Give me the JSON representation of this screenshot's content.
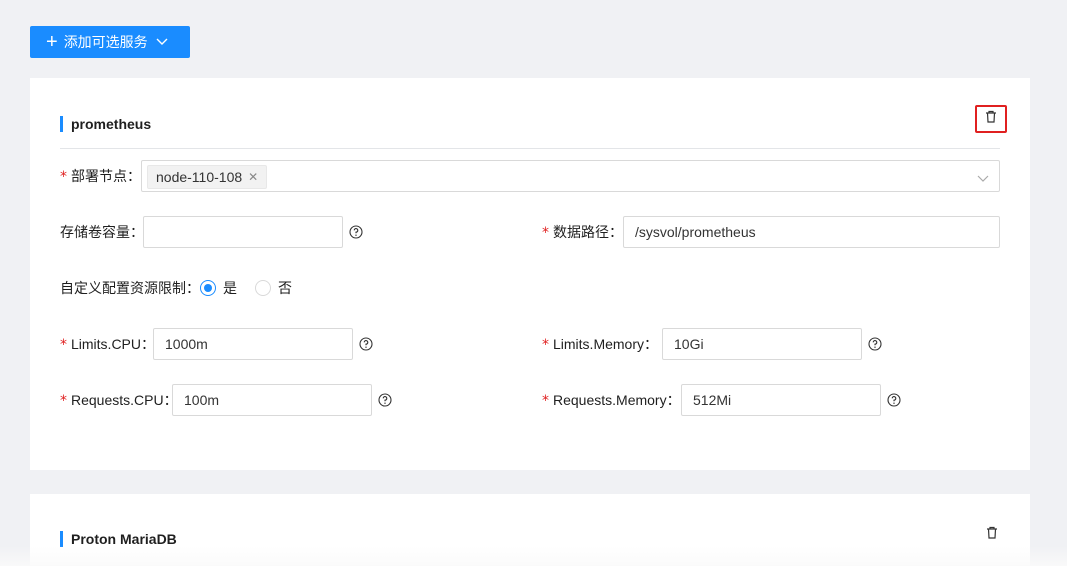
{
  "toolbar": {
    "add_label": "添加可选服务"
  },
  "card1": {
    "title": "prometheus",
    "deploy_node": {
      "label": "部署节点",
      "tag": "node-110-108"
    },
    "storage": {
      "label": "存储卷容量",
      "value": ""
    },
    "data_path": {
      "label": "数据路径",
      "value": "/sysvol/prometheus"
    },
    "custom_limit": {
      "label": "自定义配置资源限制",
      "yes": "是",
      "no": "否",
      "selected": "是"
    },
    "limits_cpu": {
      "label": "Limits.CPU",
      "value": "1000m"
    },
    "limits_memory": {
      "label": "Limits.Memory",
      "value": "10Gi"
    },
    "requests_cpu": {
      "label": "Requests.CPU",
      "value": "100m"
    },
    "requests_memory": {
      "label": "Requests.Memory",
      "value": "512Mi"
    },
    "colon": "："
  },
  "card2": {
    "title": "Proton MariaDB"
  },
  "colors": {
    "primary": "#1a8cff",
    "required": "#e02020",
    "highlight": "#e02020"
  }
}
